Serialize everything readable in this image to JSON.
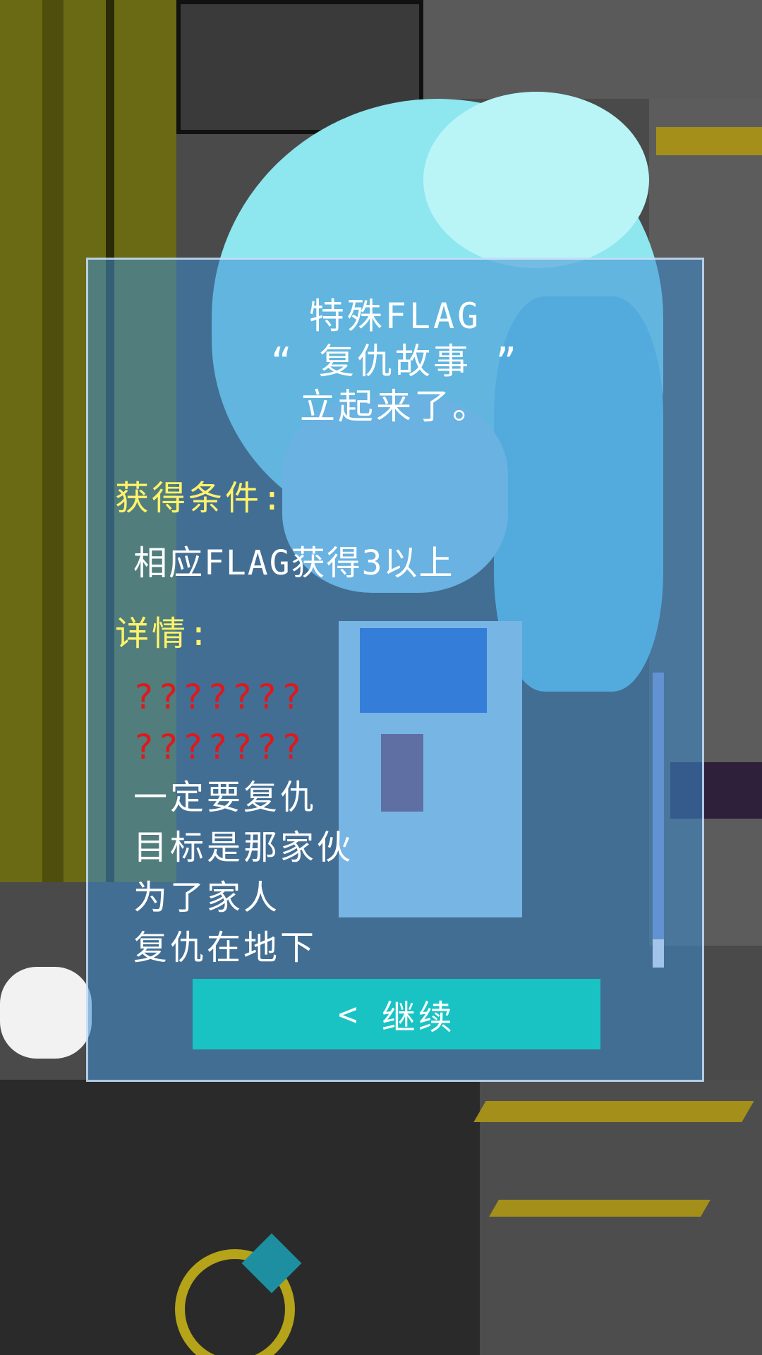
{
  "dialog": {
    "title_lines": [
      "特殊FLAG",
      "“ 复仇故事 ”",
      "立起来了。"
    ],
    "condition_label": "获得条件:",
    "condition_value": "相应FLAG获得3以上",
    "details_label": "详情:",
    "details": [
      {
        "text": "???????",
        "locked": true
      },
      {
        "text": "???????",
        "locked": true
      },
      {
        "text": "一定要复仇",
        "locked": false
      },
      {
        "text": "目标是那家伙",
        "locked": false
      },
      {
        "text": "为了家人",
        "locked": false
      },
      {
        "text": "复仇在地下",
        "locked": false
      }
    ],
    "continue_icon": "chevron-left-icon",
    "continue_label": "继续"
  },
  "colors": {
    "panel": "#3c8cd2",
    "label": "#fff36a",
    "locked_text": "#e0181c",
    "button": "#19c3c3"
  }
}
